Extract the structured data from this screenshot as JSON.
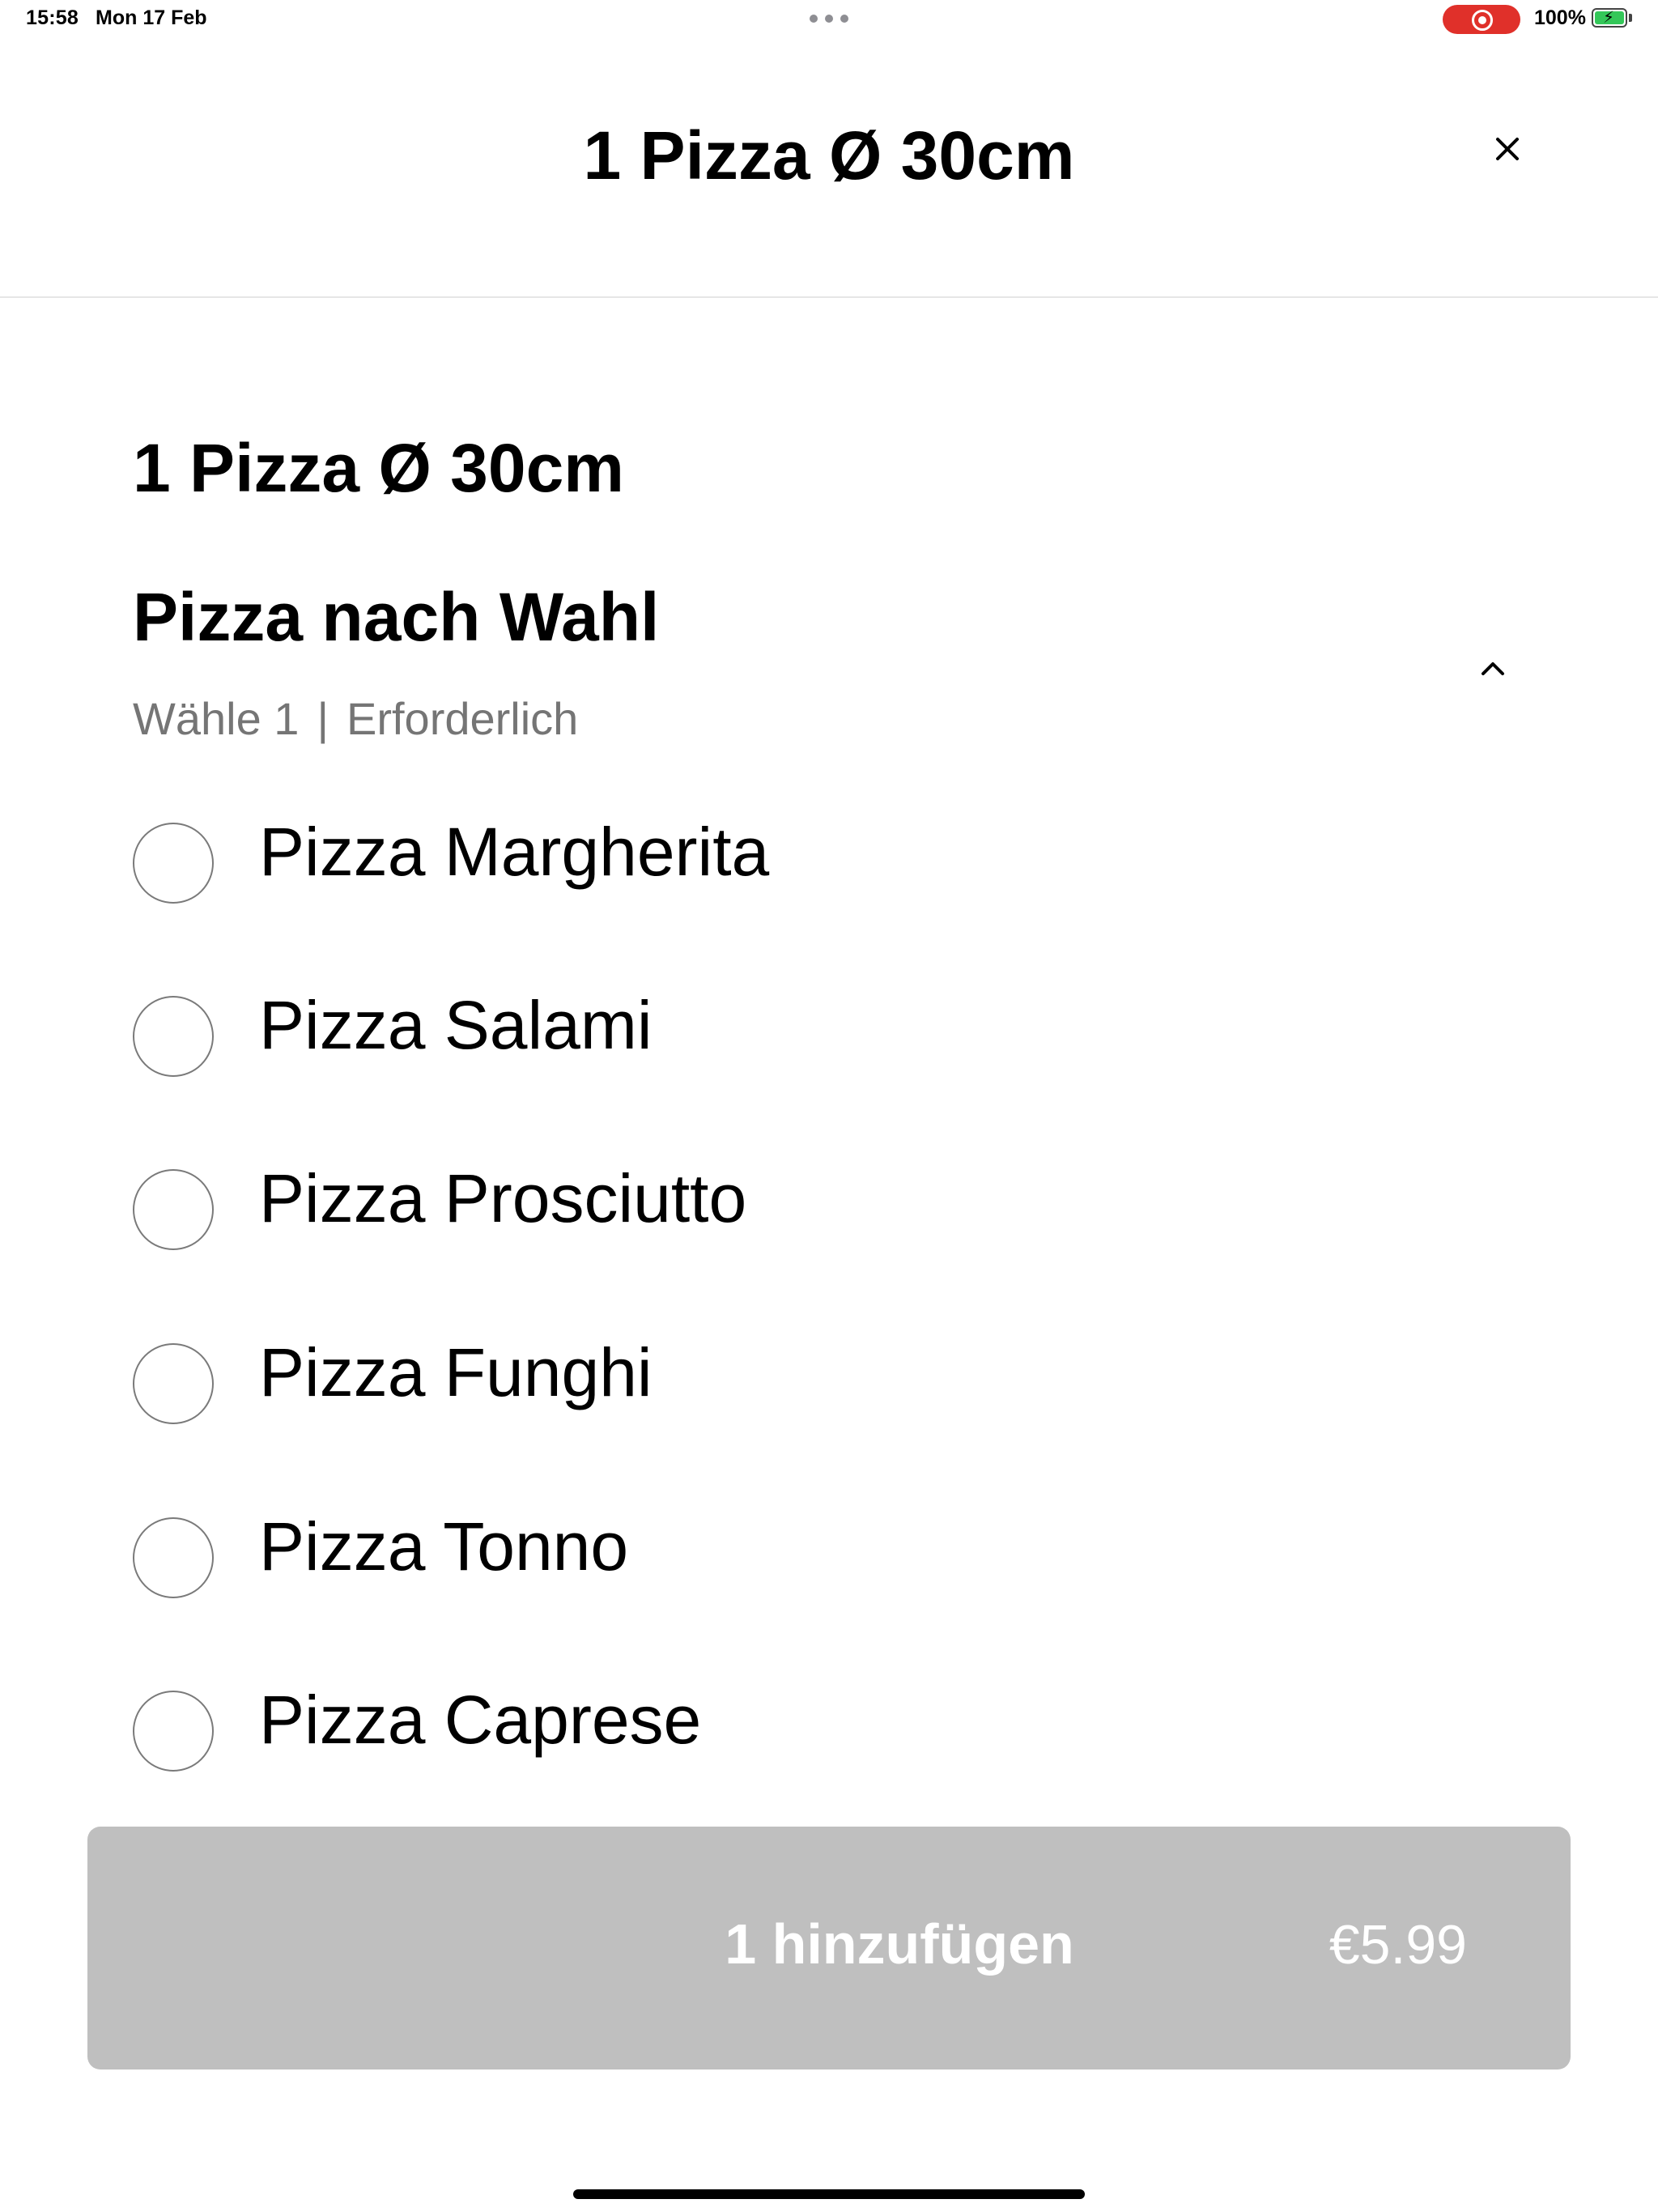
{
  "status_bar": {
    "time": "15:58",
    "date": "Mon 17 Feb",
    "battery_percent": "100%",
    "battery_level": 1.0,
    "recording_color": "#e0302a",
    "battery_color": "#34c759"
  },
  "header": {
    "title": "1 Pizza Ø 30cm",
    "close_icon": "close-icon"
  },
  "product": {
    "title": "1 Pizza Ø 30cm"
  },
  "section": {
    "title": "Pizza nach Wahl",
    "choose_text": "Wähle 1",
    "separator": "|",
    "required_text": "Erforderlich",
    "toggle_icon": "chevron-up-icon"
  },
  "options": [
    {
      "label": "Pizza Margherita",
      "selected": false
    },
    {
      "label": "Pizza Salami",
      "selected": false
    },
    {
      "label": "Pizza Prosciutto",
      "selected": false
    },
    {
      "label": "Pizza Funghi",
      "selected": false
    },
    {
      "label": "Pizza Tonno",
      "selected": false
    },
    {
      "label": "Pizza Caprese",
      "selected": false
    }
  ],
  "add_button": {
    "label": "1 hinzufügen",
    "price": "€5.99",
    "background_color": "#bfbfbf",
    "disabled": true
  }
}
